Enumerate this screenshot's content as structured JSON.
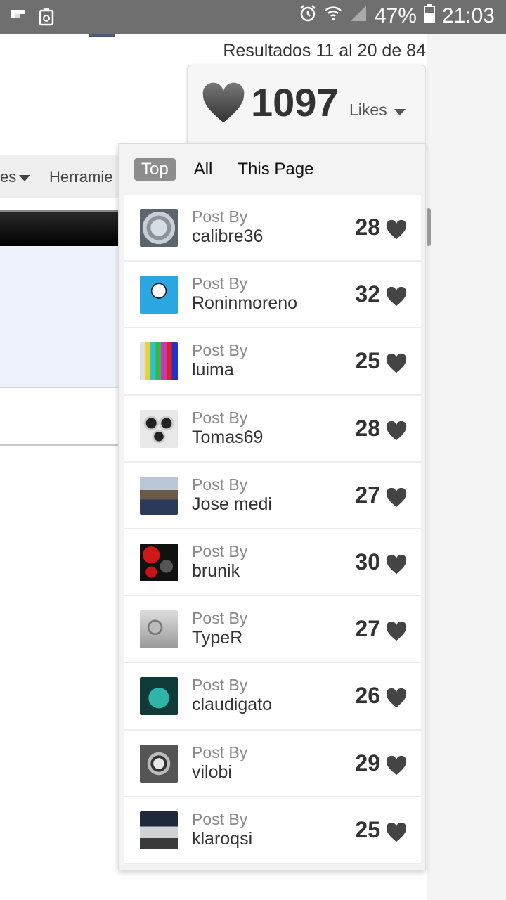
{
  "status_bar": {
    "battery": "47%",
    "time": "21:03"
  },
  "background": {
    "results": "Resultados 11 al 20 de 84",
    "tab_partial_1": "es",
    "tab_partial_2": "Herramie"
  },
  "likes": {
    "count": "1097",
    "label": "Likes"
  },
  "filters": [
    {
      "label": "Top",
      "active": true
    },
    {
      "label": "All",
      "active": false
    },
    {
      "label": "This Page",
      "active": false
    }
  ],
  "posts": [
    {
      "prefix": "Post By",
      "user": "calibre36",
      "likes": "28",
      "avatar": "watch-dial"
    },
    {
      "prefix": "Post By",
      "user": "Roninmoreno",
      "likes": "32",
      "avatar": "skull-blue"
    },
    {
      "prefix": "Post By",
      "user": "luima",
      "likes": "25",
      "avatar": "test-pattern"
    },
    {
      "prefix": "Post By",
      "user": "Tomas69",
      "likes": "28",
      "avatar": "watches-group"
    },
    {
      "prefix": "Post By",
      "user": "Jose medi",
      "likes": "27",
      "avatar": "crowd-photo"
    },
    {
      "prefix": "Post By",
      "user": "brunik",
      "likes": "30",
      "avatar": "red-bird"
    },
    {
      "prefix": "Post By",
      "user": "TypeR",
      "likes": "27",
      "avatar": "watches-grey"
    },
    {
      "prefix": "Post By",
      "user": "claudigato",
      "likes": "26",
      "avatar": "teal-cat"
    },
    {
      "prefix": "Post By",
      "user": "vilobi",
      "likes": "29",
      "avatar": "chronograph"
    },
    {
      "prefix": "Post By",
      "user": "klaroqsi",
      "likes": "25",
      "avatar": "car-photo"
    }
  ],
  "colors": {
    "status_bar": "#6f6f6f",
    "active_filter": "#8d8d8d",
    "heart": "#444444"
  }
}
